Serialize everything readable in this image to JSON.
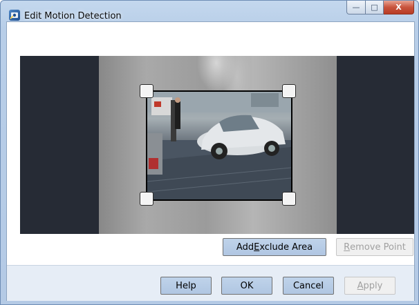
{
  "window": {
    "title": "Edit Motion Detection",
    "icon": "motion-settings-icon"
  },
  "caption_buttons": {
    "minimize_glyph": "—",
    "maximize_glyph": "□",
    "close_glyph": "X"
  },
  "buttons": {
    "add_exclude_area": {
      "before": "Add ",
      "mnemonic": "E",
      "after": "xclude Area"
    },
    "remove_point": {
      "before": "",
      "mnemonic": "R",
      "after": "emove Point"
    },
    "help": "Help",
    "ok": "OK",
    "cancel": "Cancel",
    "apply": {
      "before": "",
      "mnemonic": "A",
      "after": "pply"
    }
  },
  "colors": {
    "preview_background": "#262b35",
    "button_fill": "#b4c9e4",
    "disabled_text": "#a0a0a0",
    "close_button": "#c8533c"
  }
}
